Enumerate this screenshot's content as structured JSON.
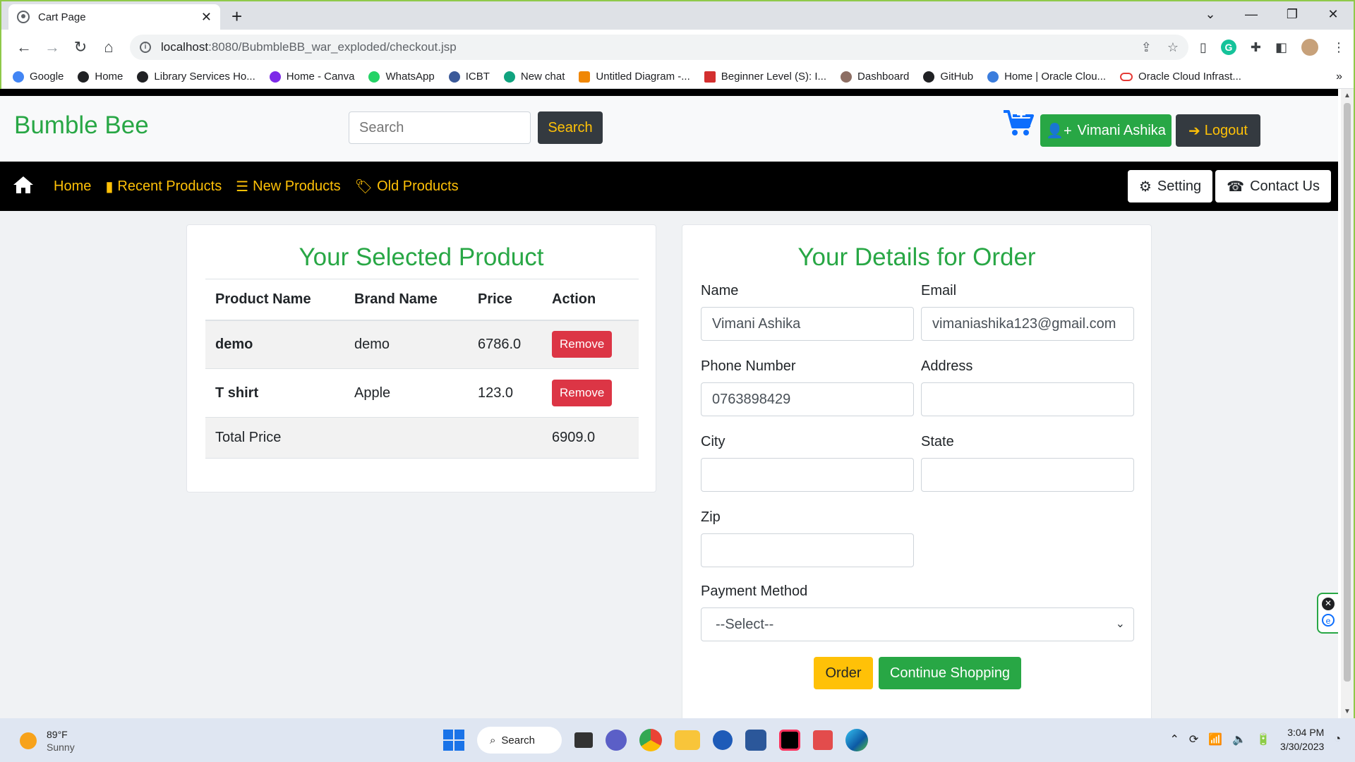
{
  "browser": {
    "tab_title": "Cart Page",
    "url_host": "localhost",
    "url_path": ":8080/BubmbleBB_war_exploded/checkout.jsp",
    "bookmarks": [
      "Google",
      "Home",
      "Library Services Ho...",
      "Home - Canva",
      "WhatsApp",
      "ICBT",
      "New chat",
      "Untitled Diagram -...",
      "Beginner Level (S): I...",
      "Dashboard",
      "GitHub",
      "Home | Oracle Clou...",
      "Oracle Cloud Infrast..."
    ],
    "bookmark_colors": [
      "#4285f4",
      "#202124",
      "#202124",
      "#7d2ae8",
      "#25d366",
      "#3c5a99",
      "#10a37f",
      "#f08705",
      "#d32f2f",
      "#8d6e63",
      "#202124",
      "#3b7ddd",
      "#e53935"
    ]
  },
  "site": {
    "brand": "Bumble Bee",
    "search_placeholder": "Search",
    "search_button": "Search",
    "user_button": "Vimani Ashika",
    "logout_button": "Logout",
    "nav": {
      "home": "Home",
      "recent": "Recent Products",
      "new": "New Products",
      "old": "Old Products",
      "setting": "Setting",
      "contact": "Contact Us"
    },
    "colors": {
      "brand": "#28a745",
      "accent": "#ffc107",
      "danger": "#dc3545",
      "dark": "#343a40"
    }
  },
  "cart": {
    "title": "Your Selected Product",
    "headers": {
      "product": "Product Name",
      "brand": "Brand Name",
      "price": "Price",
      "action": "Action"
    },
    "items": [
      {
        "product": "demo",
        "brand": "demo",
        "price": "6786.0",
        "action": "Remove"
      },
      {
        "product": "T shirt",
        "brand": "Apple",
        "price": "123.0",
        "action": "Remove"
      }
    ],
    "total_label": "Total Price",
    "total_value": "6909.0"
  },
  "order_form": {
    "title": "Your Details for Order",
    "name_label": "Name",
    "name_value": "Vimani Ashika",
    "email_label": "Email",
    "email_value": "vimaniashika123@gmail.com",
    "phone_label": "Phone Number",
    "phone_value": "0763898429",
    "address_label": "Address",
    "address_value": "",
    "city_label": "City",
    "city_value": "",
    "state_label": "State",
    "state_value": "",
    "zip_label": "Zip",
    "zip_value": "",
    "payment_label": "Payment Method",
    "payment_selected": "--Select--",
    "order_button": "Order",
    "continue_button": "Continue Shopping"
  },
  "taskbar": {
    "temperature": "89°F",
    "condition": "Sunny",
    "search_label": "Search",
    "time": "3:04 PM",
    "date": "3/30/2023"
  }
}
